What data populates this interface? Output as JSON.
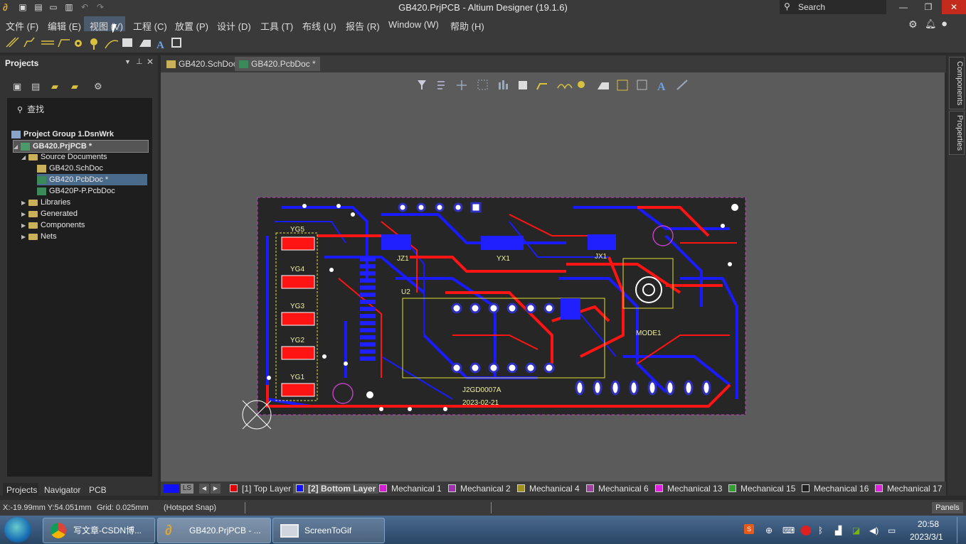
{
  "window": {
    "title": "GB420.PrjPCB - Altium Designer (19.1.6)",
    "search_placeholder": "Search"
  },
  "menu": [
    "文件 (F)",
    "编辑 (E)",
    "视图 (V)",
    "工程 (C)",
    "放置 (P)",
    "设计 (D)",
    "工具 (T)",
    "布线 (U)",
    "报告 (R)",
    "Window (W)",
    "帮助 (H)"
  ],
  "projects_panel": {
    "title": "Projects",
    "search": "查找",
    "tree": {
      "group": "Project Group 1.DsnWrk",
      "project": "GB420.PrjPCB *",
      "source_docs": "Source Documents",
      "docs": [
        "GB420.SchDoc",
        "GB420.PcbDoc *",
        "GB420P-P.PcbDoc"
      ],
      "folders": [
        "Libraries",
        "Generated",
        "Components",
        "Nets"
      ]
    },
    "bottom_tabs": [
      "Projects",
      "Navigator",
      "PCB"
    ]
  },
  "doc_tabs": [
    "GB420.SchDoc",
    "GB420.PcbDoc *"
  ],
  "right_tabs": [
    "Components",
    "Properties"
  ],
  "layers": {
    "ls": "LS",
    "items": [
      {
        "label": "[1] Top Layer",
        "color": "#e00000"
      },
      {
        "label": "[2] Bottom Layer",
        "color": "#1010ff"
      },
      {
        "label": "Mechanical 1",
        "color": "#d020d0"
      },
      {
        "label": "Mechanical 2",
        "color": "#a030b0"
      },
      {
        "label": "Mechanical 4",
        "color": "#a09020"
      },
      {
        "label": "Mechanical 6",
        "color": "#a040a0"
      },
      {
        "label": "Mechanical 13",
        "color": "#e020e0"
      },
      {
        "label": "Mechanical 15",
        "color": "#30a030"
      },
      {
        "label": "Mechanical 16",
        "color": "#202020"
      },
      {
        "label": "Mechanical 17",
        "color": "#e020e0"
      }
    ]
  },
  "status": {
    "coords": "X:-19.99mm Y:54.051mm",
    "grid": "Grid: 0.025mm",
    "snap": "(Hotspot Snap)",
    "panels": "Panels"
  },
  "taskbar": {
    "tasks": [
      "写文章-CSDN博...",
      "GB420.PrjPCB - ...",
      "ScreenToGif"
    ],
    "time": "20:58",
    "date": "2023/3/1"
  },
  "pcb": {
    "labels": [
      "YG5",
      "YG4",
      "YG3",
      "YG2",
      "YG1",
      "U2",
      "JZ1",
      "YX1",
      "JX1",
      "MODE1",
      "J2GD0007A",
      "2023-02-21"
    ]
  }
}
